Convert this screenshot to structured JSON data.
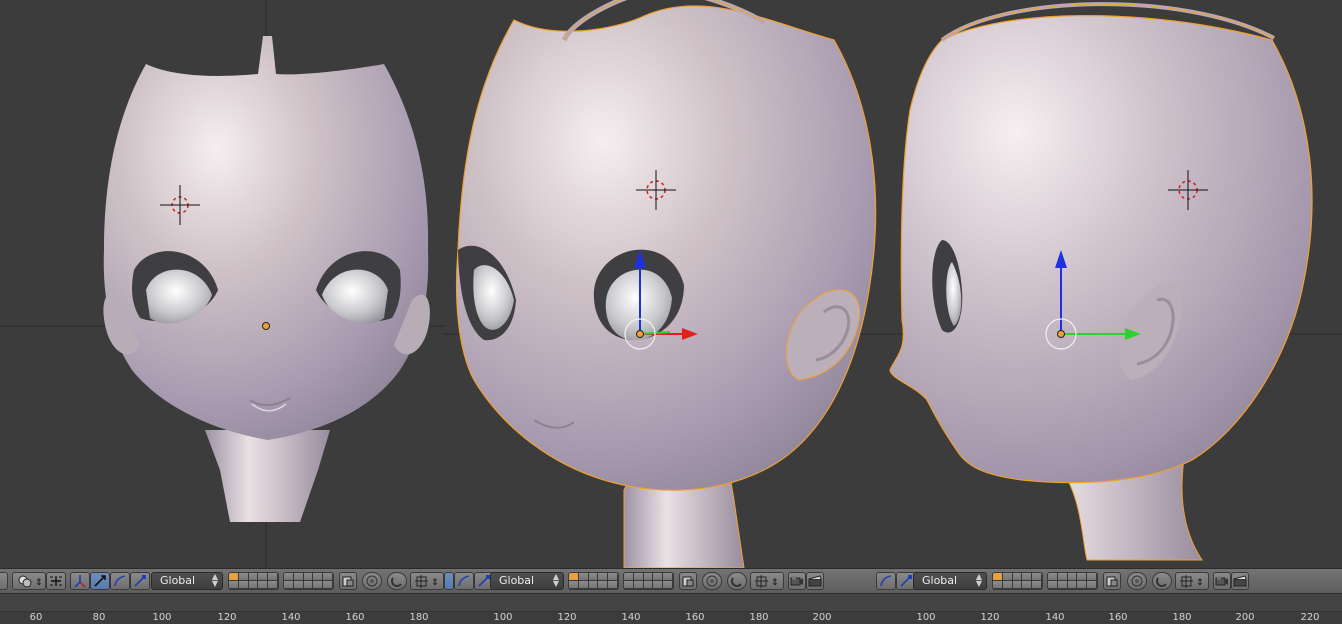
{
  "toolbars": [
    {
      "transform_orientation": "Global"
    },
    {
      "transform_orientation": "Global"
    },
    {
      "transform_orientation": "Global"
    }
  ],
  "timeline": {
    "ticks": [
      {
        "label": "60"
      },
      {
        "label": "80"
      },
      {
        "label": "100"
      },
      {
        "label": "120"
      },
      {
        "label": "140"
      },
      {
        "label": "160"
      },
      {
        "label": "180"
      },
      {
        "label": "100"
      },
      {
        "label": "120"
      },
      {
        "label": "140"
      },
      {
        "label": "160"
      },
      {
        "label": "180"
      },
      {
        "label": "200"
      },
      {
        "label": "100"
      },
      {
        "label": "120"
      },
      {
        "label": "140"
      },
      {
        "label": "160"
      },
      {
        "label": "180"
      },
      {
        "label": "200"
      },
      {
        "label": "220"
      }
    ]
  },
  "icons": {
    "cursor": "3d-cursor-icon",
    "manipulator": "manipulator-icon",
    "pivot": "pivot-point-icon",
    "layers": "layer-buttons-icon",
    "snap": "snap-magnet-icon",
    "render": "render-camera-icon"
  },
  "colors": {
    "viewport_bg": "#3c3c3c",
    "selection_outline": "#f0a030",
    "axis_x": "#e02020",
    "axis_y": "#30d030",
    "axis_z": "#2030e0"
  }
}
